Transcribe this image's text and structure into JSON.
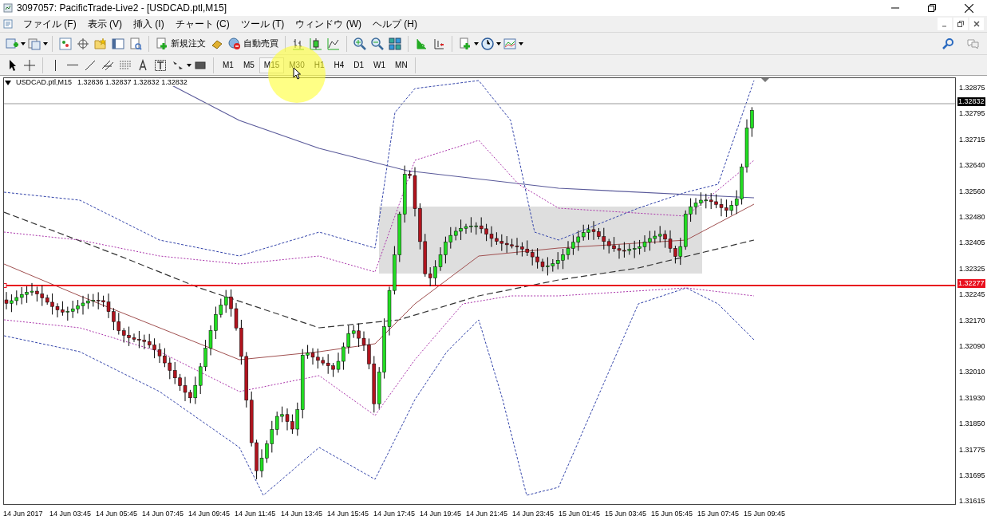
{
  "window": {
    "title": "3097057: PacificTrade-Live2 - [USDCAD.ptl,M15]"
  },
  "menu": [
    "ファイル (F)",
    "表示 (V)",
    "挿入 (I)",
    "チャート (C)",
    "ツール (T)",
    "ウィンドウ (W)",
    "ヘルプ (H)"
  ],
  "toolbar": {
    "new_order": "新規注文",
    "auto_trading": "自動売買"
  },
  "timeframes": [
    {
      "label": "M1",
      "selected": false
    },
    {
      "label": "M5",
      "selected": false
    },
    {
      "label": "M15",
      "selected": true
    },
    {
      "label": "M30",
      "selected": false
    },
    {
      "label": "H1",
      "selected": false
    },
    {
      "label": "H4",
      "selected": false
    },
    {
      "label": "D1",
      "selected": false
    },
    {
      "label": "W1",
      "selected": false
    },
    {
      "label": "MN",
      "selected": false
    }
  ],
  "chart": {
    "symbol": "USDCAD.ptl,M15",
    "quotes": "1.32836 1.32837 1.32832 1.32832",
    "price_labels": [
      "1.32875",
      "1.32795",
      "1.32715",
      "1.32640",
      "1.32560",
      "1.32480",
      "1.32405",
      "1.32325",
      "1.32245",
      "1.32170",
      "1.32090",
      "1.32010",
      "1.31930",
      "1.31850",
      "1.31775",
      "1.31695",
      "1.31615"
    ],
    "current_price": "1.32832",
    "line_price": "1.32277",
    "time_labels": [
      "14 Jun 2017",
      "14 Jun 03:45",
      "14 Jun 05:45",
      "14 Jun 07:45",
      "14 Jun 09:45",
      "14 Jun 11:45",
      "14 Jun 13:45",
      "14 Jun 15:45",
      "14 Jun 17:45",
      "14 Jun 19:45",
      "14 Jun 21:45",
      "14 Jun 23:45",
      "15 Jun 01:45",
      "15 Jun 03:45",
      "15 Jun 05:45",
      "15 Jun 07:45",
      "15 Jun 09:45"
    ]
  }
}
